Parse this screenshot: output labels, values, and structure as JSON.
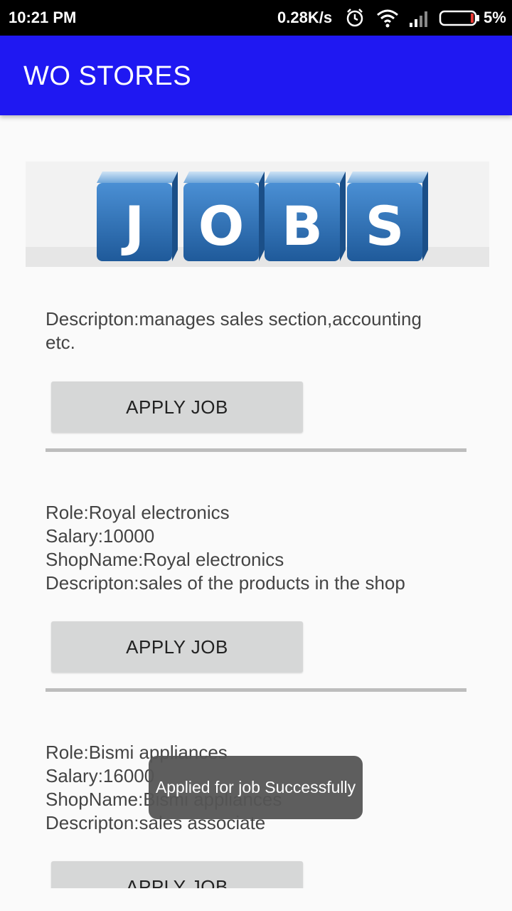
{
  "status_bar": {
    "time": "10:21 PM",
    "net_speed": "0.28K/s",
    "battery": "5%",
    "icons": [
      "alarm-icon",
      "wifi-icon",
      "signal-icon",
      "battery-icon"
    ]
  },
  "app_bar": {
    "title": "WO STORES"
  },
  "banner": {
    "letters": [
      "J",
      "O",
      "B",
      "S"
    ]
  },
  "jobs": [
    {
      "lines": [
        "Descripton:manages sales section,accounting",
        "etc."
      ],
      "button": "APPLY JOB"
    },
    {
      "lines": [
        "Role:Royal electronics",
        "Salary:10000",
        "ShopName:Royal electronics",
        "Descripton:sales of the products in the shop"
      ],
      "button": "APPLY JOB"
    },
    {
      "lines": [
        "Role:Bismi appliances",
        "Salary:16000",
        "ShopName:Bismi appliances",
        "Descripton:sales associate"
      ],
      "button": "APPLY JOB"
    }
  ],
  "toast": {
    "message": "Applied for job Successfully"
  },
  "colors": {
    "app_bar": "#1f18f2",
    "button": "#d6d7d7",
    "divider": "#bdbdbd",
    "cube": "#2f75bd"
  }
}
